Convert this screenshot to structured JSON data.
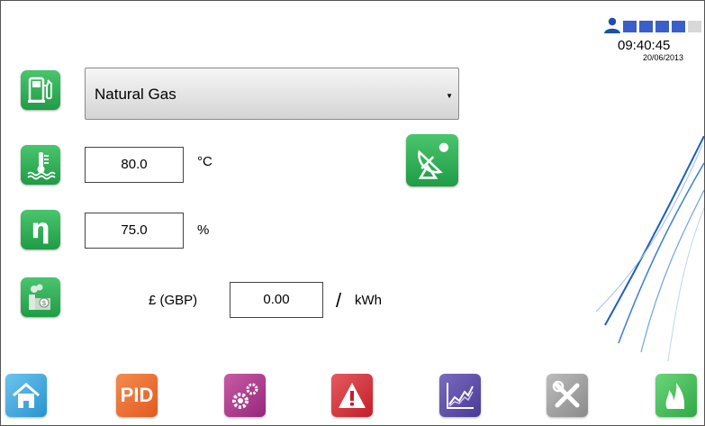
{
  "fuel": {
    "selected": "Natural Gas",
    "icon": "fuel-pump-icon"
  },
  "temperature": {
    "value": "80.0",
    "unit": "°C",
    "icon": "water-temperature-icon"
  },
  "efficiency": {
    "value": "75.0",
    "unit": "%",
    "symbol": "η"
  },
  "cost": {
    "currency_label": "£ (GBP)",
    "value": "0.00",
    "separator": "/",
    "unit": "kWh",
    "icon": "fuel-cost-icon"
  },
  "status": {
    "time": "09:40:45",
    "date": "20/06/2013",
    "icons": [
      "user-icon",
      "signal-block-icon"
    ]
  },
  "nav": [
    {
      "name": "home",
      "label": ""
    },
    {
      "name": "pid",
      "label": "PID"
    },
    {
      "name": "settings",
      "label": ""
    },
    {
      "name": "alarm",
      "label": ""
    },
    {
      "name": "trend",
      "label": ""
    },
    {
      "name": "tools",
      "label": ""
    },
    {
      "name": "flame",
      "label": ""
    }
  ],
  "colors": {
    "green": "#2fae57",
    "home": "#3aa8dc",
    "pid": "#ef6b2c",
    "settings": "#b03a8e",
    "alarm": "#d6303a",
    "trend": "#5a4aa6",
    "tools": "#9a9a9a",
    "flame": "#4cbf5a"
  }
}
